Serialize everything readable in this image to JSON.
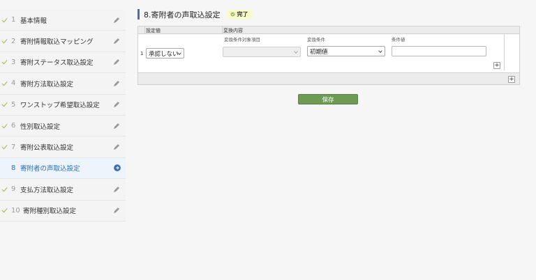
{
  "sidebar": {
    "steps": [
      {
        "num": "1",
        "label": "基本情報"
      },
      {
        "num": "2",
        "label": "寄附情報取込マッピング"
      },
      {
        "num": "3",
        "label": "寄附ステータス取込設定"
      },
      {
        "num": "4",
        "label": "寄附方法取込設定"
      },
      {
        "num": "5",
        "label": "ワンストップ希望取込設定"
      },
      {
        "num": "6",
        "label": "性別取込設定"
      },
      {
        "num": "7",
        "label": "寄附公表取込設定"
      },
      {
        "num": "8",
        "label": "寄附者の声取込設定"
      },
      {
        "num": "9",
        "label": "支払方法取込設定"
      },
      {
        "num": "10",
        "label": "寄附種別取込設定"
      }
    ],
    "active_index": 7
  },
  "main": {
    "title": "8.寄附者の声取込設定",
    "status_badge": "完了",
    "table": {
      "col_setting_value": "設定値",
      "col_conversion": "変換内容",
      "sub_target_item": "変換条件対象項目",
      "sub_condition": "変換条件",
      "sub_condition_value": "条件値",
      "row_number": "1",
      "setting_value": "承認しない",
      "target_item": "",
      "condition": "初期値",
      "condition_value": ""
    },
    "add_condition_label": "+",
    "add_row_label": "+",
    "save_label": "保存"
  },
  "colors": {
    "accent": "#4a6fa5",
    "save_button": "#6e9a55",
    "badge_bg": "#fafcc8",
    "check_color": "#a6b84a",
    "active_arrow": "#3b6fb6"
  },
  "icons": [
    "check-icon",
    "pencil-icon",
    "arrow-right-circle-icon",
    "checkmark-circle-icon",
    "plus-icon",
    "chevron-down-icon"
  ]
}
